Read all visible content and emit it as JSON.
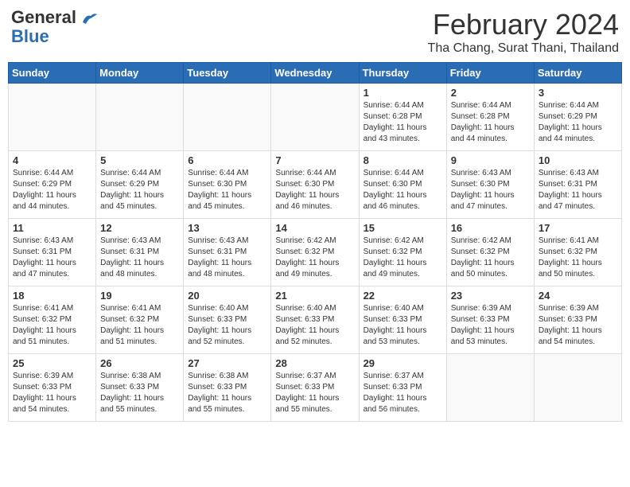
{
  "header": {
    "logo_general": "General",
    "logo_blue": "Blue",
    "calendar_title": "February 2024",
    "calendar_subtitle": "Tha Chang, Surat Thani, Thailand"
  },
  "weekdays": [
    "Sunday",
    "Monday",
    "Tuesday",
    "Wednesday",
    "Thursday",
    "Friday",
    "Saturday"
  ],
  "weeks": [
    [
      {
        "day": "",
        "info": ""
      },
      {
        "day": "",
        "info": ""
      },
      {
        "day": "",
        "info": ""
      },
      {
        "day": "",
        "info": ""
      },
      {
        "day": "1",
        "info": "Sunrise: 6:44 AM\nSunset: 6:28 PM\nDaylight: 11 hours\nand 43 minutes."
      },
      {
        "day": "2",
        "info": "Sunrise: 6:44 AM\nSunset: 6:28 PM\nDaylight: 11 hours\nand 44 minutes."
      },
      {
        "day": "3",
        "info": "Sunrise: 6:44 AM\nSunset: 6:29 PM\nDaylight: 11 hours\nand 44 minutes."
      }
    ],
    [
      {
        "day": "4",
        "info": "Sunrise: 6:44 AM\nSunset: 6:29 PM\nDaylight: 11 hours\nand 44 minutes."
      },
      {
        "day": "5",
        "info": "Sunrise: 6:44 AM\nSunset: 6:29 PM\nDaylight: 11 hours\nand 45 minutes."
      },
      {
        "day": "6",
        "info": "Sunrise: 6:44 AM\nSunset: 6:30 PM\nDaylight: 11 hours\nand 45 minutes."
      },
      {
        "day": "7",
        "info": "Sunrise: 6:44 AM\nSunset: 6:30 PM\nDaylight: 11 hours\nand 46 minutes."
      },
      {
        "day": "8",
        "info": "Sunrise: 6:44 AM\nSunset: 6:30 PM\nDaylight: 11 hours\nand 46 minutes."
      },
      {
        "day": "9",
        "info": "Sunrise: 6:43 AM\nSunset: 6:30 PM\nDaylight: 11 hours\nand 47 minutes."
      },
      {
        "day": "10",
        "info": "Sunrise: 6:43 AM\nSunset: 6:31 PM\nDaylight: 11 hours\nand 47 minutes."
      }
    ],
    [
      {
        "day": "11",
        "info": "Sunrise: 6:43 AM\nSunset: 6:31 PM\nDaylight: 11 hours\nand 47 minutes."
      },
      {
        "day": "12",
        "info": "Sunrise: 6:43 AM\nSunset: 6:31 PM\nDaylight: 11 hours\nand 48 minutes."
      },
      {
        "day": "13",
        "info": "Sunrise: 6:43 AM\nSunset: 6:31 PM\nDaylight: 11 hours\nand 48 minutes."
      },
      {
        "day": "14",
        "info": "Sunrise: 6:42 AM\nSunset: 6:32 PM\nDaylight: 11 hours\nand 49 minutes."
      },
      {
        "day": "15",
        "info": "Sunrise: 6:42 AM\nSunset: 6:32 PM\nDaylight: 11 hours\nand 49 minutes."
      },
      {
        "day": "16",
        "info": "Sunrise: 6:42 AM\nSunset: 6:32 PM\nDaylight: 11 hours\nand 50 minutes."
      },
      {
        "day": "17",
        "info": "Sunrise: 6:41 AM\nSunset: 6:32 PM\nDaylight: 11 hours\nand 50 minutes."
      }
    ],
    [
      {
        "day": "18",
        "info": "Sunrise: 6:41 AM\nSunset: 6:32 PM\nDaylight: 11 hours\nand 51 minutes."
      },
      {
        "day": "19",
        "info": "Sunrise: 6:41 AM\nSunset: 6:32 PM\nDaylight: 11 hours\nand 51 minutes."
      },
      {
        "day": "20",
        "info": "Sunrise: 6:40 AM\nSunset: 6:33 PM\nDaylight: 11 hours\nand 52 minutes."
      },
      {
        "day": "21",
        "info": "Sunrise: 6:40 AM\nSunset: 6:33 PM\nDaylight: 11 hours\nand 52 minutes."
      },
      {
        "day": "22",
        "info": "Sunrise: 6:40 AM\nSunset: 6:33 PM\nDaylight: 11 hours\nand 53 minutes."
      },
      {
        "day": "23",
        "info": "Sunrise: 6:39 AM\nSunset: 6:33 PM\nDaylight: 11 hours\nand 53 minutes."
      },
      {
        "day": "24",
        "info": "Sunrise: 6:39 AM\nSunset: 6:33 PM\nDaylight: 11 hours\nand 54 minutes."
      }
    ],
    [
      {
        "day": "25",
        "info": "Sunrise: 6:39 AM\nSunset: 6:33 PM\nDaylight: 11 hours\nand 54 minutes."
      },
      {
        "day": "26",
        "info": "Sunrise: 6:38 AM\nSunset: 6:33 PM\nDaylight: 11 hours\nand 55 minutes."
      },
      {
        "day": "27",
        "info": "Sunrise: 6:38 AM\nSunset: 6:33 PM\nDaylight: 11 hours\nand 55 minutes."
      },
      {
        "day": "28",
        "info": "Sunrise: 6:37 AM\nSunset: 6:33 PM\nDaylight: 11 hours\nand 55 minutes."
      },
      {
        "day": "29",
        "info": "Sunrise: 6:37 AM\nSunset: 6:33 PM\nDaylight: 11 hours\nand 56 minutes."
      },
      {
        "day": "",
        "info": ""
      },
      {
        "day": "",
        "info": ""
      }
    ]
  ]
}
